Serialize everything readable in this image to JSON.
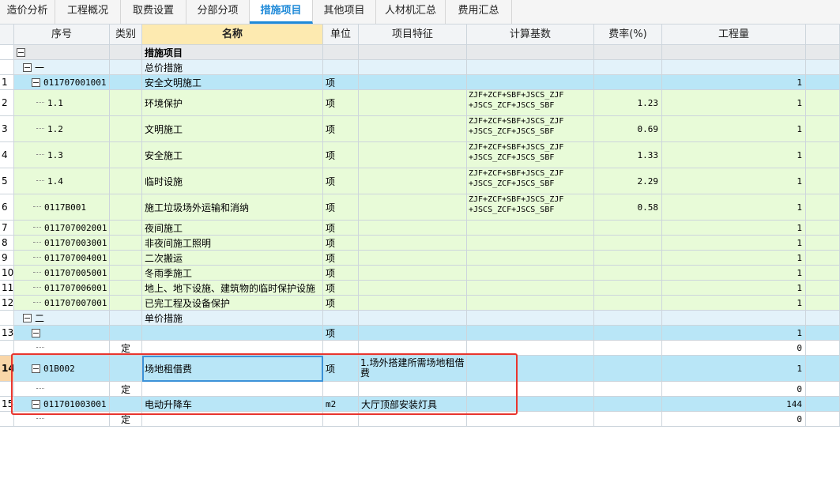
{
  "tabs": [
    "造价分析",
    "工程概况",
    "取费设置",
    "分部分项",
    "措施项目",
    "其他项目",
    "人材机汇总",
    "费用汇总"
  ],
  "active_tab": "措施项目",
  "columns": {
    "seq": "序号",
    "type": "类别",
    "name": "名称",
    "unit": "单位",
    "feature": "项目特征",
    "base": "计算基数",
    "rate": "费率(%)",
    "qty": "工程量"
  },
  "rows": [
    {
      "rn": "",
      "code": "",
      "type": "",
      "name": "措施项目",
      "unit": "",
      "feature": "",
      "base": "",
      "rate": "",
      "qty": ""
    },
    {
      "rn": "",
      "code": "一",
      "type": "",
      "name": "总价措施",
      "unit": "",
      "feature": "",
      "base": "",
      "rate": "",
      "qty": ""
    },
    {
      "rn": "1",
      "code": "011707001001",
      "type": "",
      "name": "安全文明施工",
      "unit": "项",
      "feature": "",
      "base": "",
      "rate": "",
      "qty": "1"
    },
    {
      "rn": "2",
      "code": "1.1",
      "type": "",
      "name": "环境保护",
      "unit": "项",
      "feature": "",
      "base": "ZJF+ZCF+SBF+JSCS_ZJF +JSCS_ZCF+JSCS_SBF",
      "rate": "1.23",
      "qty": "1"
    },
    {
      "rn": "3",
      "code": "1.2",
      "type": "",
      "name": "文明施工",
      "unit": "项",
      "feature": "",
      "base": "ZJF+ZCF+SBF+JSCS_ZJF +JSCS_ZCF+JSCS_SBF",
      "rate": "0.69",
      "qty": "1"
    },
    {
      "rn": "4",
      "code": "1.3",
      "type": "",
      "name": "安全施工",
      "unit": "项",
      "feature": "",
      "base": "ZJF+ZCF+SBF+JSCS_ZJF +JSCS_ZCF+JSCS_SBF",
      "rate": "1.33",
      "qty": "1"
    },
    {
      "rn": "5",
      "code": "1.4",
      "type": "",
      "name": "临时设施",
      "unit": "项",
      "feature": "",
      "base": "ZJF+ZCF+SBF+JSCS_ZJF +JSCS_ZCF+JSCS_SBF",
      "rate": "2.29",
      "qty": "1"
    },
    {
      "rn": "6",
      "code": "0117B001",
      "type": "",
      "name": "施工垃圾场外运输和消纳",
      "unit": "项",
      "feature": "",
      "base": "ZJF+ZCF+SBF+JSCS_ZJF +JSCS_ZCF+JSCS_SBF",
      "rate": "0.58",
      "qty": "1"
    },
    {
      "rn": "7",
      "code": "011707002001",
      "type": "",
      "name": "夜间施工",
      "unit": "项",
      "feature": "",
      "base": "",
      "rate": "",
      "qty": "1"
    },
    {
      "rn": "8",
      "code": "011707003001",
      "type": "",
      "name": "非夜间施工照明",
      "unit": "项",
      "feature": "",
      "base": "",
      "rate": "",
      "qty": "1"
    },
    {
      "rn": "9",
      "code": "011707004001",
      "type": "",
      "name": "二次搬运",
      "unit": "项",
      "feature": "",
      "base": "",
      "rate": "",
      "qty": "1"
    },
    {
      "rn": "10",
      "code": "011707005001",
      "type": "",
      "name": "冬雨季施工",
      "unit": "项",
      "feature": "",
      "base": "",
      "rate": "",
      "qty": "1"
    },
    {
      "rn": "11",
      "code": "011707006001",
      "type": "",
      "name": "地上、地下设施、建筑物的临时保护设施",
      "unit": "项",
      "feature": "",
      "base": "",
      "rate": "",
      "qty": "1"
    },
    {
      "rn": "12",
      "code": "011707007001",
      "type": "",
      "name": "已完工程及设备保护",
      "unit": "项",
      "feature": "",
      "base": "",
      "rate": "",
      "qty": "1"
    },
    {
      "rn": "",
      "code": "二",
      "type": "",
      "name": "单价措施",
      "unit": "",
      "feature": "",
      "base": "",
      "rate": "",
      "qty": ""
    },
    {
      "rn": "13",
      "code": "",
      "type": "",
      "name": "",
      "unit": "项",
      "feature": "",
      "base": "",
      "rate": "",
      "qty": "1"
    },
    {
      "rn": "",
      "code": "",
      "type": "定",
      "name": "",
      "unit": "",
      "feature": "",
      "base": "",
      "rate": "",
      "qty": "0"
    },
    {
      "rn": "14",
      "code": "01B002",
      "type": "",
      "name": "场地租借费",
      "unit": "项",
      "feature": "1.场外搭建所需场地租借费",
      "base": "",
      "rate": "",
      "qty": "1"
    },
    {
      "rn": "",
      "code": "",
      "type": "定",
      "name": "",
      "unit": "",
      "feature": "",
      "base": "",
      "rate": "",
      "qty": "0"
    },
    {
      "rn": "15",
      "code": "011701003001",
      "type": "",
      "name": "电动升降车",
      "unit": "m2",
      "feature": "大厅顶部安装灯具",
      "base": "",
      "rate": "",
      "qty": "144"
    },
    {
      "rn": "",
      "code": "",
      "type": "定",
      "name": "",
      "unit": "",
      "feature": "",
      "base": "",
      "rate": "",
      "qty": "0"
    }
  ]
}
